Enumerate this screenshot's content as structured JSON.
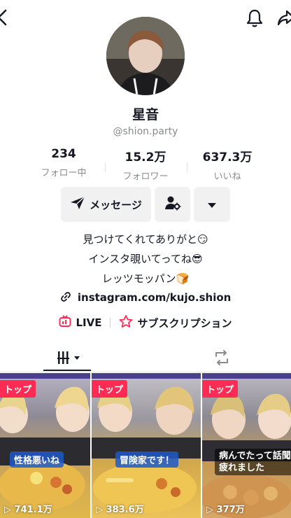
{
  "profile": {
    "display_name": "星音",
    "handle": "@shion.party"
  },
  "stats": [
    {
      "value": "234",
      "label": "フォロー中"
    },
    {
      "value": "15.2万",
      "label": "フォロワー"
    },
    {
      "value": "637.3万",
      "label": "いいね"
    }
  ],
  "actions": {
    "message_label": "メッセージ"
  },
  "bio": {
    "line1": "見つけてくれてありがと😏",
    "line2": "インスタ覗いてってね😎",
    "line3": "レッツモッパン🍞",
    "link": "instagram.com/kujo.shion"
  },
  "features": {
    "live_label": "LIVE",
    "subscription_label": "サブスクリプション"
  },
  "videos": [
    {
      "badge": "トップ",
      "caption": "性格悪いね",
      "views": "741.1万"
    },
    {
      "badge": "トップ",
      "caption": "冒険家です！",
      "views": "383.6万"
    },
    {
      "badge": "トップ",
      "caption": "病んでたって話聞く\n疲れました",
      "views": "377万"
    }
  ],
  "colors": {
    "accent": "#fe2c55",
    "text": "#161823",
    "muted": "#8a8b91",
    "button_bg": "#f1f1f2"
  }
}
